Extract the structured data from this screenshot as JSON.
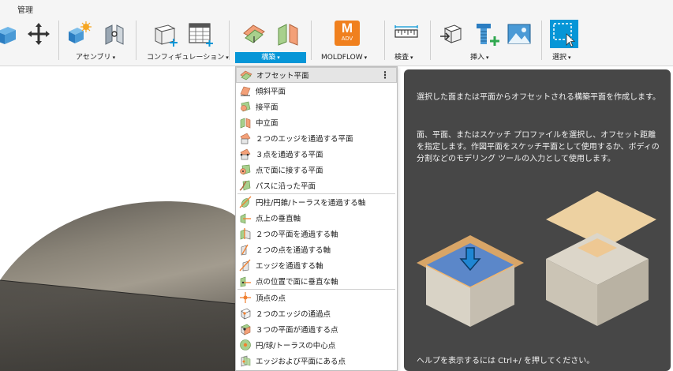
{
  "app": {
    "tab_manage": "管理"
  },
  "toolbar": {
    "groups": [
      {
        "label": "アセンブリ"
      },
      {
        "label": "コンフィギュレーション"
      },
      {
        "label": "構築"
      },
      {
        "label": "MOLDFLOW"
      },
      {
        "label": "検査"
      },
      {
        "label": "挿入"
      },
      {
        "label": "選択"
      }
    ],
    "caret": "▾",
    "moldflow_badge_letter": "M",
    "moldflow_badge_sub": "ADV",
    "colors": {
      "accent": "#0696d7",
      "moldflow_orange": "#f0801e"
    }
  },
  "menu": {
    "more_glyph": "⋮",
    "items": [
      {
        "label": "オフセット平面",
        "icon": "offset-plane-icon"
      },
      {
        "label": "傾斜平面",
        "icon": "plane-at-angle-icon"
      },
      {
        "label": "接平面",
        "icon": "tangent-plane-icon"
      },
      {
        "label": "中立面",
        "icon": "midplane-icon"
      },
      {
        "label": "２つのエッジを通過する平面",
        "icon": "plane-through-two-edges-icon"
      },
      {
        "label": "３点を通過する平面",
        "icon": "plane-through-three-points-icon"
      },
      {
        "label": "点で面に接する平面",
        "icon": "plane-tangent-at-point-icon"
      },
      {
        "label": "パスに沿った平面",
        "icon": "plane-along-path-icon"
      },
      {
        "label": "円柱/円錐/トーラスを通過する軸",
        "icon": "axis-through-cylinder-icon"
      },
      {
        "label": "点上の垂直軸",
        "icon": "axis-perpendicular-at-point-icon"
      },
      {
        "label": "２つの平面を通過する軸",
        "icon": "axis-through-two-planes-icon"
      },
      {
        "label": "２つの点を通過する軸",
        "icon": "axis-through-two-points-icon"
      },
      {
        "label": "エッジを通過する軸",
        "icon": "axis-through-edge-icon"
      },
      {
        "label": "点の位置で面に垂直な軸",
        "icon": "axis-perpendicular-to-face-icon"
      },
      {
        "label": "頂点の点",
        "icon": "point-at-vertex-icon"
      },
      {
        "label": "２つのエッジの通過点",
        "icon": "point-through-two-edges-icon"
      },
      {
        "label": "３つの平面が通過する点",
        "icon": "point-through-three-planes-icon"
      },
      {
        "label": "円/球/トーラスの中心点",
        "icon": "point-at-center-icon"
      },
      {
        "label": "エッジおよび平面にある点",
        "icon": "point-at-edge-and-plane-icon"
      }
    ]
  },
  "tooltip": {
    "title": "選択した面または平面からオフセットされる構築平面を作成します。",
    "body": "面、平面、またはスケッチ プロファイルを選択し、オフセット距離を指定します。作図平面をスケッチ平面として使用するか、ボディの分割などのモデリング ツールの入力として使用します。",
    "help": "ヘルプを表示するには Ctrl+/ を押してください。"
  }
}
